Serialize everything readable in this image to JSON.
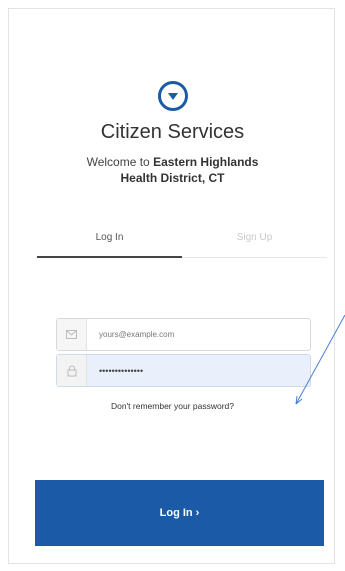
{
  "app": {
    "title": "Citizen Services",
    "welcome_prefix": "Welcome to",
    "district_line1": "Eastern Highlands",
    "district_line2": "Health District, CT"
  },
  "tabs": [
    {
      "label": "Log In",
      "active": true
    },
    {
      "label": "Sign Up",
      "active": false
    }
  ],
  "form": {
    "email_placeholder": "yours@example.com",
    "password_value": "••••••••••••••",
    "forgot_label": "Don't remember your password?",
    "login_label": "Log In ›"
  },
  "colors": {
    "brand": "#1a5aa6",
    "password_field_bg": "#eaf0fb"
  },
  "icons": {
    "logo": "circle-down-arrow-icon",
    "email": "envelope-icon",
    "password": "lock-icon",
    "annotation": "annotation-arrow"
  }
}
